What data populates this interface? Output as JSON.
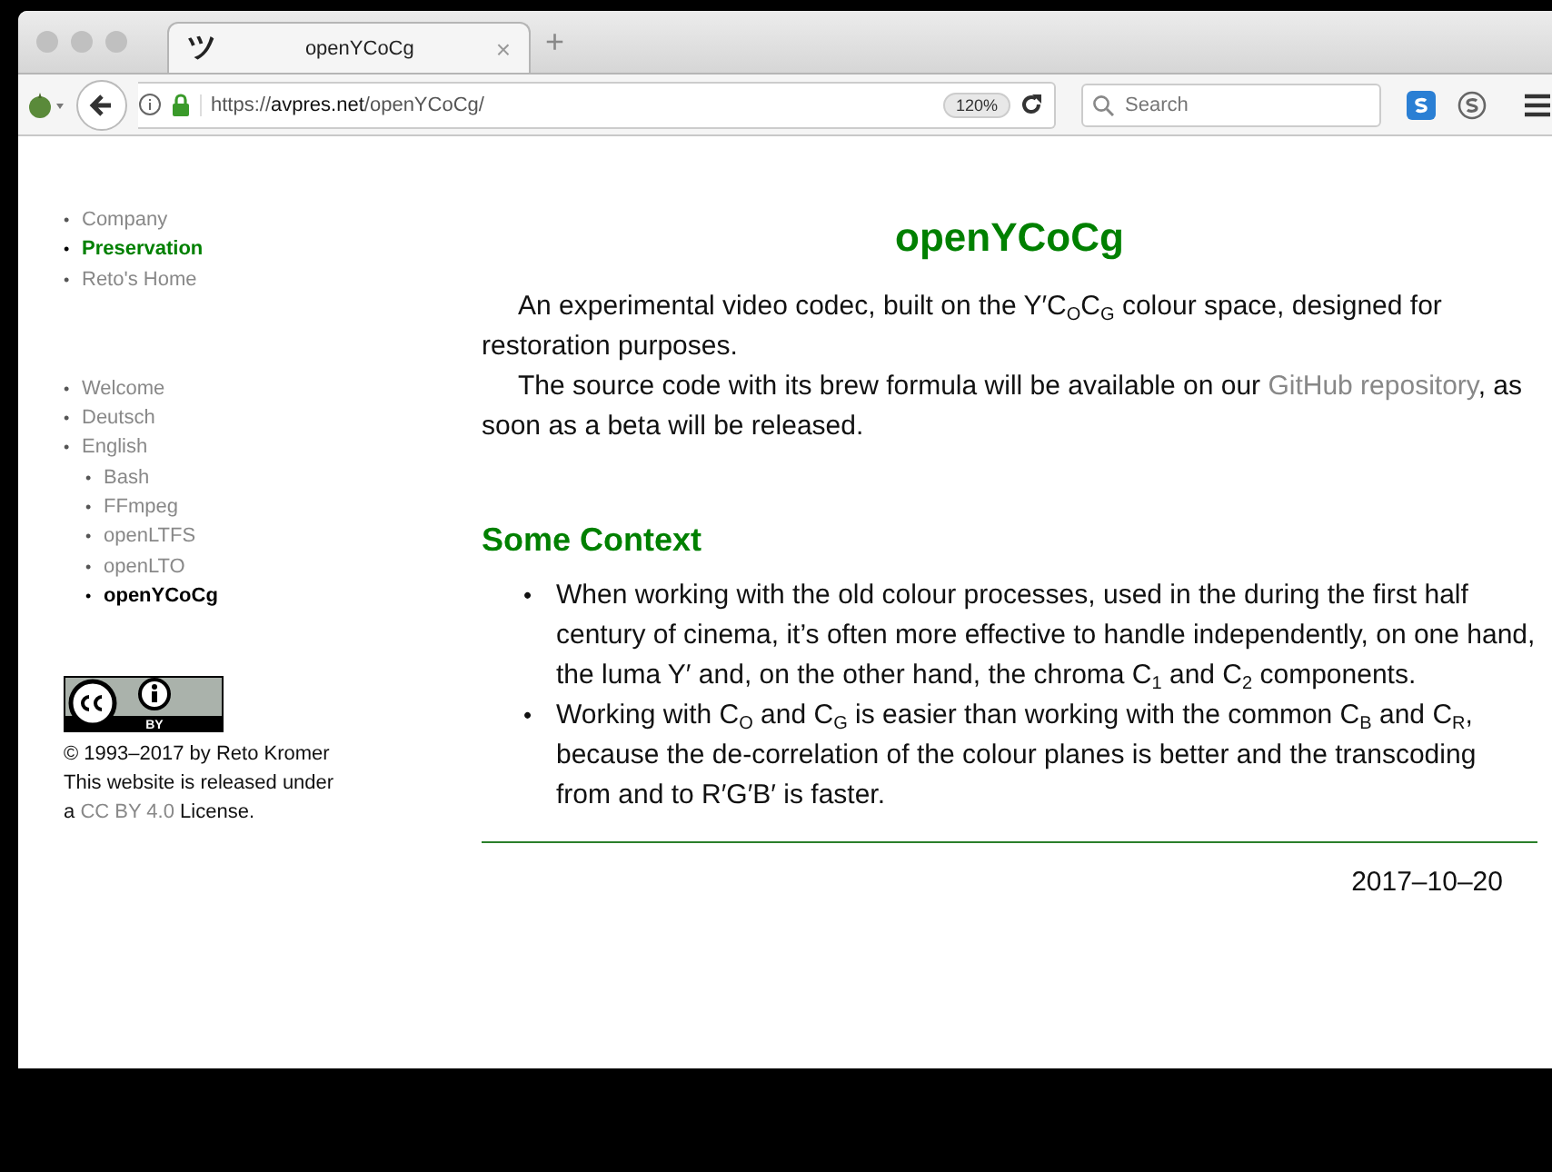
{
  "bullet": "•",
  "tab": {
    "favicon": "ツ",
    "title": "openYCoCg",
    "close": "×",
    "selected": true
  },
  "new_tab": "+",
  "toolbar": {
    "url": {
      "scheme": "https://",
      "domain": "avpres.net",
      "path": "/openYCoCg/"
    },
    "zoom": "120%",
    "search": {
      "placeholder": "Search"
    }
  },
  "nav_primary": [
    {
      "label": "Company",
      "selected": false
    },
    {
      "label": "Preservation",
      "selected": true
    },
    {
      "label": "Reto's Home",
      "selected": false
    }
  ],
  "nav_secondary": [
    {
      "label": "Welcome",
      "selected": false
    },
    {
      "label": "Deutsch",
      "selected": false
    },
    {
      "label": "English",
      "selected": false,
      "children": [
        {
          "label": "Bash",
          "selected": false
        },
        {
          "label": "FFmpeg",
          "selected": false
        },
        {
          "label": "openLTFS",
          "selected": false
        },
        {
          "label": "openLTO",
          "selected": false
        },
        {
          "label": "openYCoCg",
          "selected": true
        }
      ]
    }
  ],
  "license": {
    "badge": "BY",
    "copyright": "© 1993–2017 by Reto Kromer",
    "line1": "This website is released under",
    "before": "a ",
    "link": "CC BY 4.0",
    "after": " License."
  },
  "title": "openYCoCg",
  "paragraphs": [
    {
      "text": "An experimental video codec, built on the Y′C$_{O}$C$_{G}$ colour space, designed for restoration purposes."
    },
    {
      "text": "The source code with its brew formula will be available on our ",
      "link": "GitHub repository",
      "after": ", as soon as a beta will be released."
    }
  ],
  "section": {
    "heading": "Some Context",
    "bullets": [
      "When working with the old colour processes, used in the during the first half century of cinema, it’s often more effective to handle independently, on one hand, the luma Y′ and, on the other hand, the chroma C$_{1}$ and C$_{2}$ components.",
      "Working with C$_{O}$ and C$_{G}$ is easier than working with the common C$_{B}$ and C$_{R}$, because the de-correlation of the colour planes is better and the transcoding from and to R′G′B′ is faster."
    ]
  },
  "date": "2017–10–20"
}
